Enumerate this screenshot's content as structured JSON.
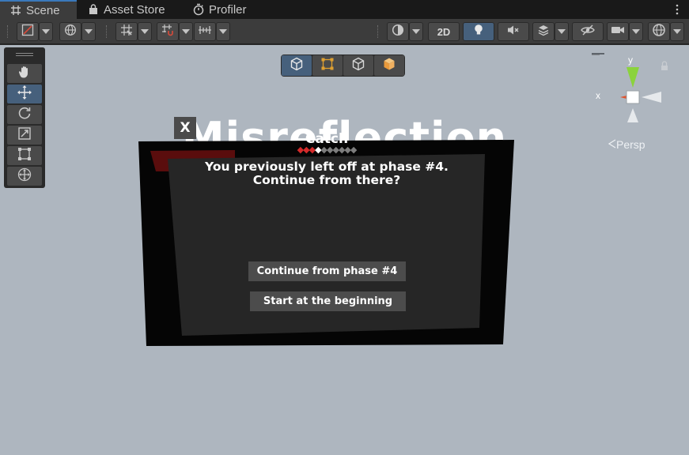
{
  "tabs": [
    {
      "label": "Scene",
      "icon": "hash-grid-icon",
      "active": true
    },
    {
      "label": "Asset Store",
      "icon": "shopping-bag-icon",
      "active": false
    },
    {
      "label": "Profiler",
      "icon": "stopwatch-icon",
      "active": false
    }
  ],
  "toolbar": {
    "toggle_2d_label": "2D"
  },
  "viewport": {
    "background": "#aeb6bf",
    "world_title": "Misreflection",
    "gizmo": {
      "x_label": "x",
      "y_label": "y",
      "projection_label": "Persp"
    }
  },
  "dialog": {
    "close_label": "X",
    "title": "Catch",
    "progress": {
      "completed": 3,
      "current": 4,
      "total": 10
    },
    "message_line1": "You previously left off at phase #4.",
    "message_line2": "Continue from there?",
    "continue_label": "Continue from phase #4",
    "restart_label": "Start at the beginning"
  },
  "colors": {
    "accent": "#3a79bb",
    "active_tool": "#46607c",
    "progress_done": "#d42a2a",
    "progress_pending": "#7d7d7d",
    "gizmo_x": "#e0532e",
    "gizmo_y": "#8bd33c"
  }
}
